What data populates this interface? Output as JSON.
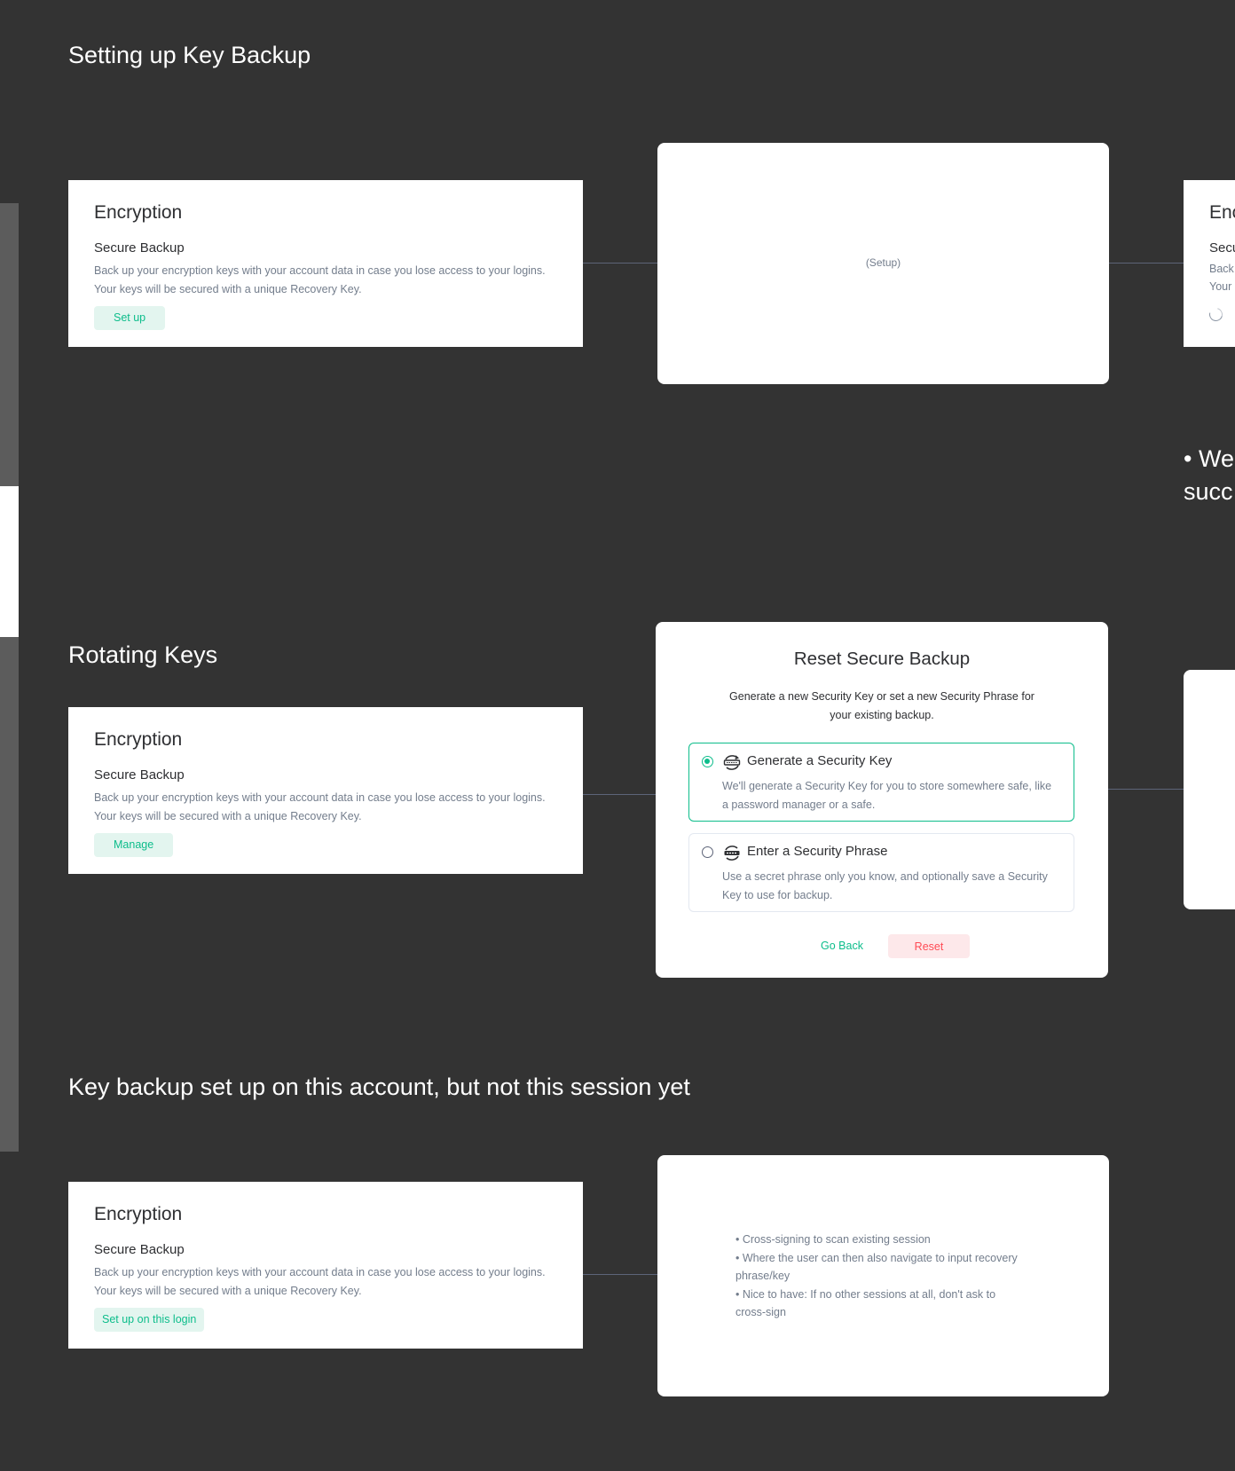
{
  "sections": {
    "setup": {
      "heading": "Setting up Key Backup"
    },
    "rotating": {
      "heading": "Rotating Keys"
    },
    "session": {
      "heading": "Key backup set up on this account, but not this session yet"
    }
  },
  "encryption_card": {
    "title": "Encryption",
    "subtitle": "Secure Backup",
    "desc_line1": "Back up your encryption keys with your account data in case you lose access to your logins.",
    "desc_line2": "Your keys will be secured with a unique Recovery Key."
  },
  "buttons": {
    "set_up": "Set up",
    "manage": "Manage",
    "set_up_on_login": "Set up on this login"
  },
  "setup_dialog": {
    "placeholder": "(Setup)"
  },
  "reset_dialog": {
    "title": "Reset Secure Backup",
    "desc_line1": "Generate a new Security Key or set a new Security Phrase for",
    "desc_line2": "your existing backup.",
    "options": [
      {
        "label": "Generate a Security Key",
        "desc_line1": "We'll generate a Security Key for you to store somewhere safe, like",
        "desc_line2": "a password manager or a safe.",
        "selected": true
      },
      {
        "label": "Enter a Security Phrase",
        "desc_line1": "Use a secret phrase only you know, and optionally save a Security",
        "desc_line2": "Key to use for backup.",
        "selected": false
      }
    ],
    "go_back": "Go Back",
    "reset": "Reset"
  },
  "session_dialog": {
    "bullets": [
      "• Cross-signing to scan existing session",
      "• Where the user can then also navigate to input recovery",
      "phrase/key",
      "• Nice to have: If no other sessions at all, don't ask to",
      "cross-sign"
    ]
  },
  "partial_right": {
    "title": "Enc",
    "subtitle": "Secu",
    "desc_line1": "Back",
    "desc_line2": "Your",
    "note_line1": "• We",
    "note_line2": "succ"
  },
  "colors": {
    "background": "#333333",
    "accent_green": "#0dbd8b",
    "danger_red": "#ff4b55",
    "muted_text": "#737d8c",
    "connector": "#5d6478"
  },
  "icons": [
    "security-key-icon",
    "security-phrase-icon",
    "radio-selected-icon",
    "radio-unselected-icon",
    "loading-spinner-icon"
  ]
}
